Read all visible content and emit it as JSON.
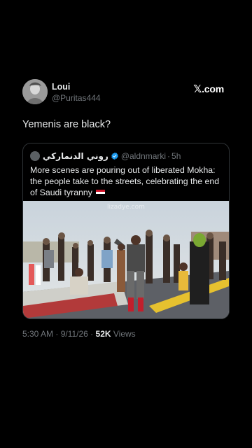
{
  "tweet": {
    "author_name": "Loui",
    "author_handle": "@Puritas444",
    "text": "Yemenis are black?",
    "timestamp": "5:30 AM · 9/11/26 · ",
    "views_count": "52K",
    "views_label": " Views"
  },
  "brand": {
    "glyph": "𝕏",
    "label": ".com"
  },
  "quote": {
    "author_name": "روني الدنماركي",
    "author_handle": "@aldnmarki",
    "dot": "·",
    "time": "5h",
    "text": "More scenes are pouring out of liberated Mokha: the people take to the streets, celebrating the end of Saudi tyranny",
    "image_watermark": "lizadye.com"
  },
  "colors": {
    "background": "#000000",
    "text_primary": "#e7e9ea",
    "text_secondary": "#71767b",
    "border": "#2f3336",
    "verified": "#1d9bf0"
  },
  "icons": {
    "verified": "verified-badge-icon",
    "flag": "yemen-flag-icon"
  }
}
